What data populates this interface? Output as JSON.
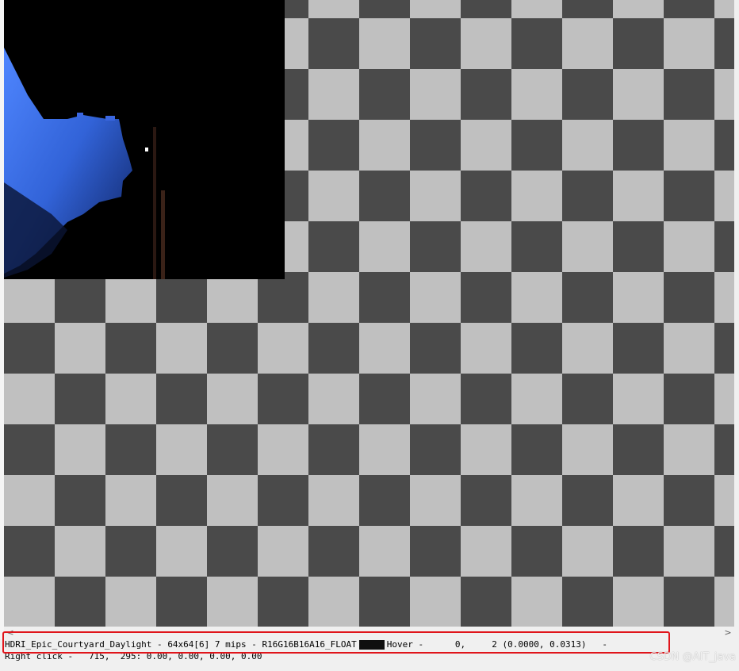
{
  "status_bar": {
    "texture_name": "HDRI_Epic_Courtyard_Daylight",
    "sep1": " - ",
    "size": "64x64[6]",
    "mips": "7 mips",
    "sep2": " - ",
    "format": "R16G16B16A16_FLOAT",
    "swatch_color": "#101010",
    "hover_label": "Hover -",
    "hover_x": "0,",
    "hover_y": "2",
    "hover_uv": "(0.0000, 0.0313)",
    "hover_trail": " -",
    "right_click": "Right click -   715,  295: 0.00, 0.00, 0.00, 0.00"
  },
  "scrollbar": {
    "left_arrow": "<",
    "right_arrow": ">"
  },
  "watermark": "CSDN @AIT_java",
  "colors": {
    "checker_dark": "#4a4a4a",
    "checker_light": "#c0c0c0",
    "highlight": "#e0151b",
    "sky_blue": "#3a6de0"
  }
}
